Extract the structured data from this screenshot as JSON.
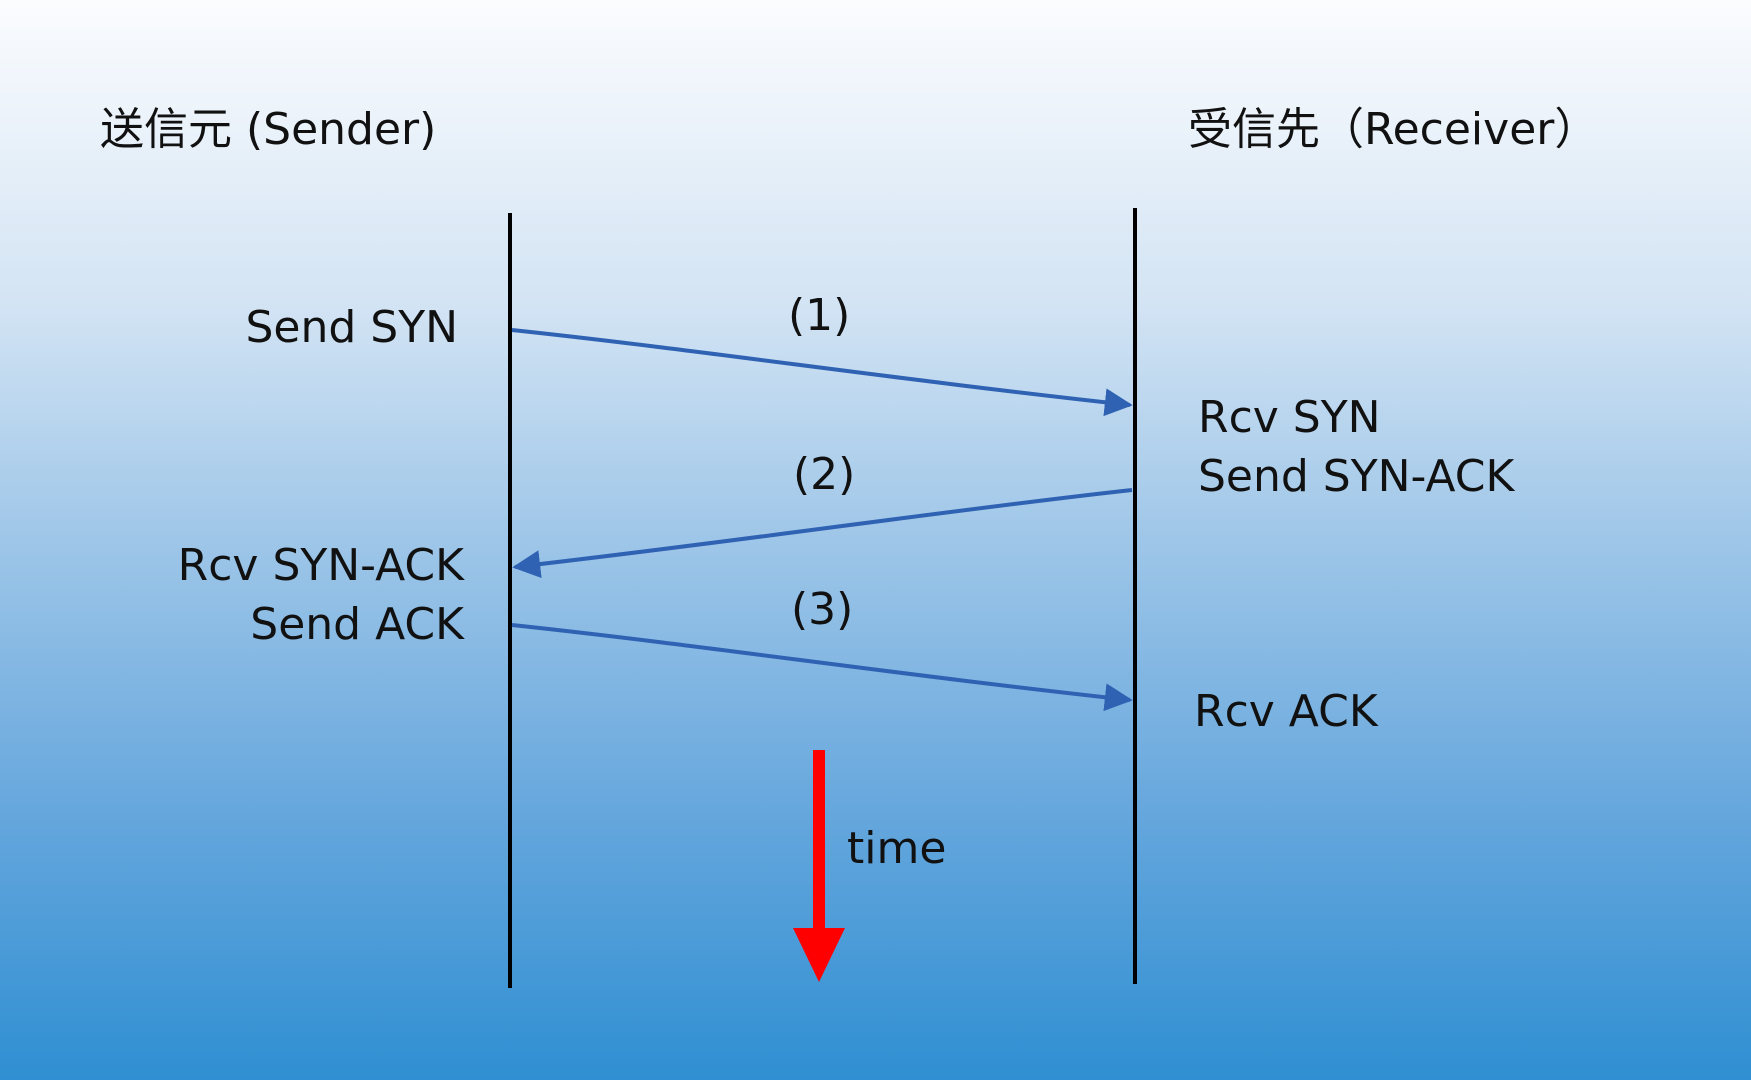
{
  "sender": {
    "title": "送信元 (Sender)",
    "steps": {
      "send_syn": "Send SYN",
      "rcv_syn_ack": "Rcv SYN-ACK",
      "send_ack": "Send ACK"
    }
  },
  "receiver": {
    "title": "受信先（Receiver）",
    "steps": {
      "rcv_syn": "Rcv SYN",
      "send_syn_ack": "Send SYN-ACK",
      "rcv_ack": "Rcv ACK"
    }
  },
  "messages": [
    {
      "label": "(1)",
      "direction": "sender-to-receiver"
    },
    {
      "label": "(2)",
      "direction": "receiver-to-sender"
    },
    {
      "label": "(3)",
      "direction": "sender-to-receiver"
    }
  ],
  "time_axis": {
    "label": "time"
  },
  "colors": {
    "message_arrow": "#2f62b3",
    "time_arrow": "#ff0000",
    "lifeline": "#000000"
  }
}
